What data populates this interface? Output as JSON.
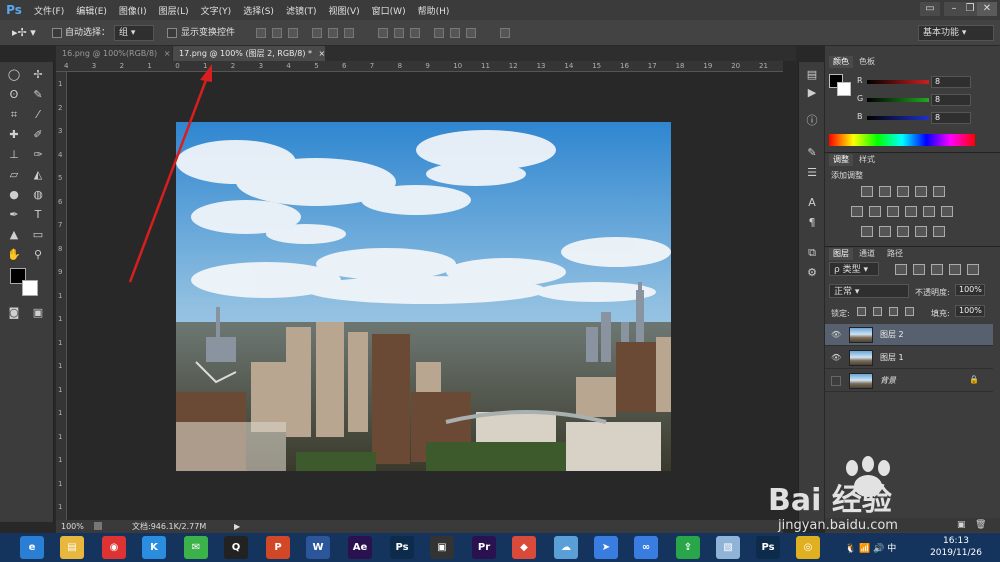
{
  "app": {
    "logo": "Ps",
    "menu": [
      "文件(F)",
      "编辑(E)",
      "图像(I)",
      "图层(L)",
      "文字(Y)",
      "选择(S)",
      "滤镜(T)",
      "视图(V)",
      "窗口(W)",
      "帮助(H)"
    ],
    "window_buttons": [
      "▭",
      "–",
      "❐",
      "✕"
    ]
  },
  "options": {
    "auto_select_label": "自动选择：",
    "group_select": "组",
    "show_transform_label": "显示变换控件",
    "workspace_select": "基本功能"
  },
  "tabs": [
    {
      "label": "16.png @ 100%(RGB/8)",
      "close": "×"
    },
    {
      "label": "17.png @ 100% (图层 2, RGB/8) *",
      "close": "×"
    }
  ],
  "ruler": {
    "top": [
      "4",
      "3",
      "2",
      "1",
      "0",
      "1",
      "2",
      "3",
      "4",
      "5",
      "6",
      "7",
      "8",
      "9",
      "10",
      "11",
      "12",
      "13",
      "14",
      "15",
      "16",
      "17",
      "18",
      "19",
      "20",
      "21"
    ],
    "left": [
      "1",
      "2",
      "3",
      "4",
      "5",
      "6",
      "7",
      "8",
      "9",
      "1",
      "1",
      "1",
      "1",
      "1",
      "1",
      "1",
      "1",
      "1",
      "1"
    ]
  },
  "status": {
    "zoom": "100%",
    "doc": "文档:946.1K/2.77M"
  },
  "color_panel": {
    "tabs": [
      "颜色",
      "色板"
    ],
    "channels": [
      {
        "name": "R",
        "value": "8",
        "color": "#cc2020"
      },
      {
        "name": "G",
        "value": "8",
        "color": "#20aa20"
      },
      {
        "name": "B",
        "value": "8",
        "color": "#2030cc"
      }
    ]
  },
  "adjust_panel": {
    "tabs": [
      "调整",
      "样式"
    ],
    "title": "添加调整"
  },
  "layers_panel": {
    "tabs": [
      "图层",
      "通道",
      "路径"
    ],
    "kind_label": "ρ 类型",
    "blend_mode": "正常",
    "opacity_label": "不透明度:",
    "opacity_value": "100%",
    "lock_label": "锁定:",
    "fill_label": "填充:",
    "fill_value": "100%",
    "layers": [
      {
        "name": "图层 2",
        "visible": true,
        "selected": true
      },
      {
        "name": "图层 1",
        "visible": true,
        "selected": false
      },
      {
        "name": "背景",
        "visible": false,
        "selected": false
      }
    ]
  },
  "taskbar": {
    "time": "16:13",
    "date": "2019/11/26",
    "apps": [
      {
        "name": "browser-icon",
        "label": "e",
        "color": "#2a7fd4"
      },
      {
        "name": "file-explorer-icon",
        "label": "▤",
        "color": "#e7b73e"
      },
      {
        "name": "netease-music-icon",
        "label": "◉",
        "color": "#d33"
      },
      {
        "name": "kugou-icon",
        "label": "K",
        "color": "#2b8de0"
      },
      {
        "name": "wechat-icon",
        "label": "✉",
        "color": "#3cb34a"
      },
      {
        "name": "qq-icon",
        "label": "Q",
        "color": "#222"
      },
      {
        "name": "powerpoint-icon",
        "label": "P",
        "color": "#d24726"
      },
      {
        "name": "word-icon",
        "label": "W",
        "color": "#2b579a"
      },
      {
        "name": "after-effects-icon",
        "label": "Ae",
        "color": "#2a1150"
      },
      {
        "name": "photoshop-icon",
        "label": "Ps",
        "color": "#0d2b4a"
      },
      {
        "name": "video-editor-icon",
        "label": "▣",
        "color": "#333"
      },
      {
        "name": "premiere-icon",
        "label": "Pr",
        "color": "#2a1150"
      },
      {
        "name": "paint-app-icon",
        "label": "◆",
        "color": "#d84b3a"
      },
      {
        "name": "cloud-app-icon",
        "label": "☁",
        "color": "#5aa0d6"
      },
      {
        "name": "feishu-icon",
        "label": "➤",
        "color": "#3a7de0"
      },
      {
        "name": "baidu-netdisk-icon",
        "label": "∞",
        "color": "#3a7de0"
      },
      {
        "name": "share-app-icon",
        "label": "⇪",
        "color": "#2aa64a"
      },
      {
        "name": "notes-app-icon",
        "label": "▧",
        "color": "#8fb4d8"
      },
      {
        "name": "photoshop-running-icon",
        "label": "Ps",
        "color": "#0d2b4a"
      },
      {
        "name": "chrome-icon",
        "label": "◎",
        "color": "#e0b020"
      }
    ]
  },
  "watermark": {
    "text": "Bai 经验",
    "url": "jingyan.baidu.com"
  }
}
